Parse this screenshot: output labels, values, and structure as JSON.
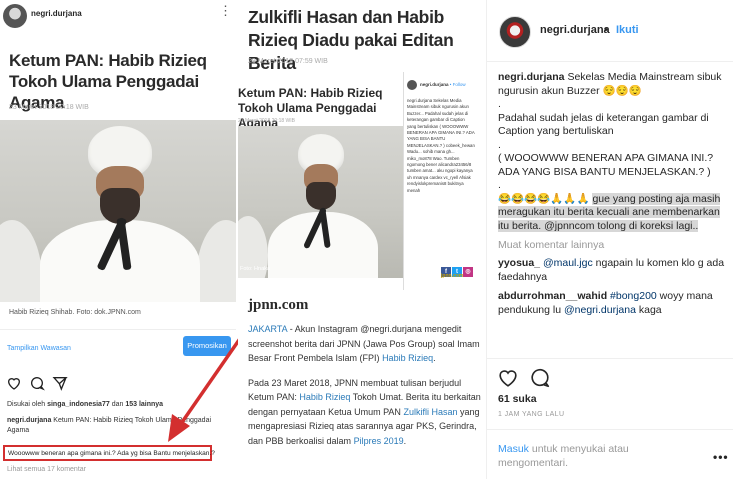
{
  "post_image": {
    "phone": {
      "username": "negri.durjana",
      "menu_icon": "vertical-dots-icon",
      "article_title": "Ketum PAN: Habib Rizieq Tokoh Ulama Penggadai Agama",
      "article_date": "23 Maret 2018 20:18 WIB",
      "photo_caption": "Habib Rizieq Shihab. Foto: dok.JPNN.com",
      "promo_link": "Tampilkan Wawasan",
      "promo_button": "Promosikan",
      "liked_prefix": "Disukai oleh",
      "liked_user": "singa_indonesia77",
      "liked_middle": "dan",
      "liked_count": "153 lainnya",
      "caption_user": "negri.durjana",
      "caption_text": "Ketum PAN: Habib Rizieq Tokoh Ulama Penggadai Agama",
      "highlighted_comment": "Wooowww beneran apa gimana ini.? Ada yg bisa Bantu menjelaskan.?",
      "view_all": "Lihat semua 17 komentar"
    },
    "article": {
      "title": "Zulkifli Hasan dan Habib Rizieq Diadu pakai Editan Berita",
      "date": "29 Maret 2018 07:59 WIB",
      "inner_title": "Ketum PAN: Habib Rizieq Tokoh Ulama Penggadai Agama",
      "inner_date": "23 Maret 2018 20:18 WIB",
      "inner_photo_caption": "Foto: Hnaka",
      "inner_user": "negri.durjana",
      "inner_follow": "• Follow",
      "inner_comments": "negri.durjana Sekelas Media Mainstream sibuk ngurusin akun Buzzer... Padahal sudah jelas di keterangan gambar di Caption yang bertuliskan ( WOOOWWW BENERAN APA GIMANA INI.? ADA YANG BISA BANTU MENJELASKAN.? ) cobeek_hewan Wadu... sohib mana gh... miko_mo878 Wao. Tumben ngomong bener alicandra23456/8 tumben amat... aku ngopi kayanya uh mnanya cardex vc_ryell Afsiak rendyislokpremanis8 bukitnya menah",
      "social_site": "jpnn.com",
      "logo": "jpnn.com",
      "p1_city": "JAKARTA",
      "p1_a": "- Akun Instagram @negri.durjana mengedit screenshot berita dari JPNN (Jawa Pos Group) soal Imam Besar Front Pembela Islam (FPI)",
      "p1_link": "Habib Rizieq",
      "p1_end": ".",
      "p2_a": "Pada 23 Maret 2018, JPNN membuat tulisan berjudul Ketum PAN:",
      "p2_link1": "Habib Rizieq",
      "p2_b": "Tokoh Umat. Berita itu berkaitan dengan pernyataan Ketua Umum PAN",
      "p2_link2": "Zulkifli Hasan",
      "p2_c": "yang mengapresiasi Rizieq atas sarannya agar PKS, Gerindra, dan PBB berkoalisi dalam",
      "p2_link3": "Pilpres 2019",
      "p2_end": "."
    }
  },
  "side": {
    "username": "negri.durjana",
    "dot": "•",
    "follow": "Ikuti",
    "caption_user": "negri.durjana",
    "caption_1": "Sekelas Media Mainstream sibuk ngurusin akun Buzzer 😌😌😌",
    "caption_dot1": ".",
    "caption_2": "Padahal sudah jelas di keterangan gambar di Caption yang bertuliskan",
    "caption_dot2": ".",
    "caption_3": "( WOOOWWW BENERAN APA GIMANA INI.? ADA YANG BISA BANTU MENJELASKAN.? )",
    "caption_dot3": ".",
    "caption_4_emoji": "😂😂😂😂🙏🙏🙏",
    "caption_4": "gue yang posting aja masih meragukan itu berita kecuali ane membenarkan itu berita. @jpnncom tolong di koreksi lagi..",
    "more_comments": "Muat komentar lainnya",
    "comments": [
      {
        "user": "yyosua_",
        "mention": "@maul.jgc",
        "text": "ngapain lu komen klo g ada faedahnya"
      },
      {
        "user": "abdurrohman__wahid",
        "mention": "#bong200",
        "text": "woyy mana pendukung lu",
        "mention2": "@negri.durjana",
        "text2": "kaga"
      }
    ],
    "heart_icon": "heart-icon",
    "comment_icon": "comment-bubble-icon",
    "likes": "61 suka",
    "time": "1 JAM YANG LALU",
    "login_link": "Masuk",
    "login_rest": "untuk menyukai atau mengomentari.",
    "more_icon": "more-horizontal-icon"
  },
  "colors": {
    "link_blue": "#3897f0",
    "highlight_red": "#d32f2f",
    "mention_blue": "#003569"
  }
}
